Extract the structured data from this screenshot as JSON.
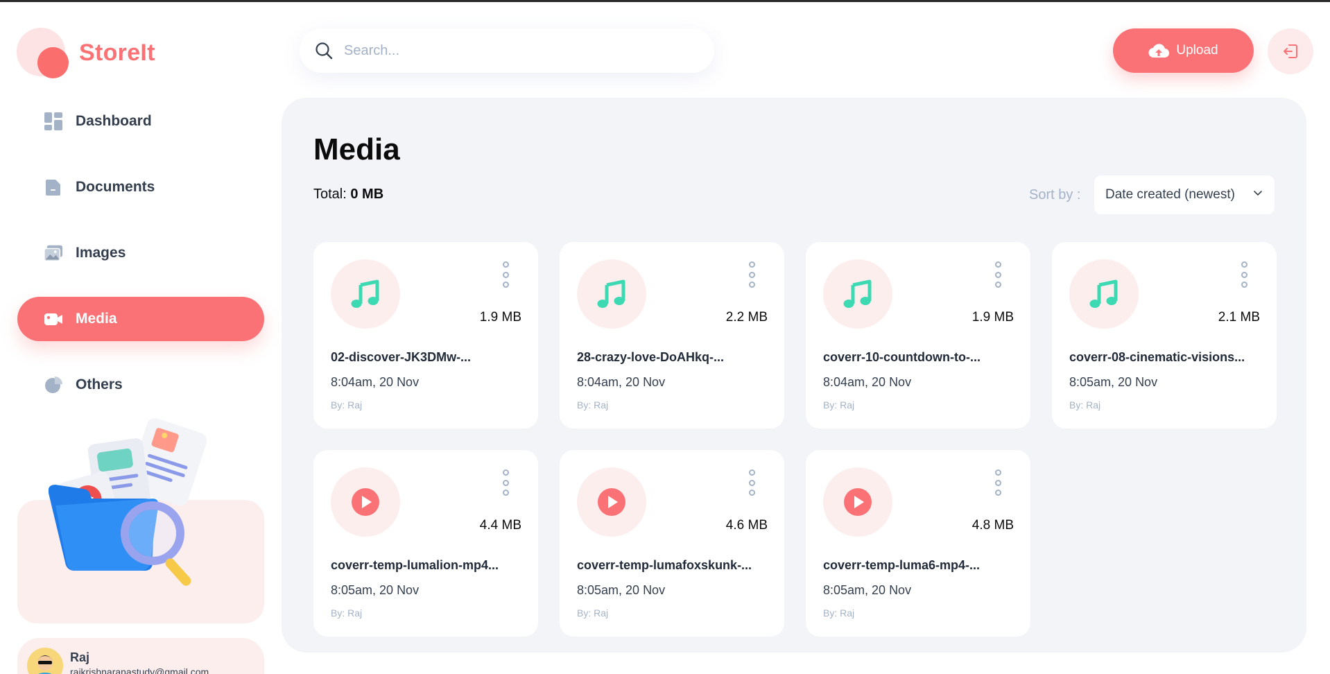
{
  "app": {
    "name": "StoreIt"
  },
  "sidebar": {
    "items": [
      {
        "label": "Dashboard",
        "icon": "dashboard-icon",
        "active": false
      },
      {
        "label": "Documents",
        "icon": "documents-icon",
        "active": false
      },
      {
        "label": "Images",
        "icon": "images-icon",
        "active": false
      },
      {
        "label": "Media",
        "icon": "media-icon",
        "active": true
      },
      {
        "label": "Others",
        "icon": "others-icon",
        "active": false
      }
    ]
  },
  "user": {
    "name": "Raj",
    "email": "rajkrishnaranastudy@gmail.com"
  },
  "search": {
    "placeholder": "Search..."
  },
  "header": {
    "upload_label": "Upload"
  },
  "page": {
    "title": "Media",
    "total_label": "Total:",
    "total_value": "0 MB",
    "sort_label": "Sort by :",
    "sort_value": "Date created (newest)"
  },
  "files": [
    {
      "name": "02-discover-JK3DMw-...",
      "size": "1.9 MB",
      "date": "8:04am, 20 Nov",
      "by": "By: Raj",
      "type": "audio"
    },
    {
      "name": "28-crazy-love-DoAHkq-...",
      "size": "2.2 MB",
      "date": "8:04am, 20 Nov",
      "by": "By: Raj",
      "type": "audio"
    },
    {
      "name": "coverr-10-countdown-to-...",
      "size": "1.9 MB",
      "date": "8:04am, 20 Nov",
      "by": "By: Raj",
      "type": "audio"
    },
    {
      "name": "coverr-08-cinematic-visions...",
      "size": "2.1 MB",
      "date": "8:05am, 20 Nov",
      "by": "By: Raj",
      "type": "audio"
    },
    {
      "name": "coverr-temp-lumalion-mp4...",
      "size": "4.4 MB",
      "date": "8:05am, 20 Nov",
      "by": "By: Raj",
      "type": "video"
    },
    {
      "name": "coverr-temp-lumafoxskunk-...",
      "size": "4.6 MB",
      "date": "8:05am, 20 Nov",
      "by": "By: Raj",
      "type": "video"
    },
    {
      "name": "coverr-temp-luma6-mp4-...",
      "size": "4.8 MB",
      "date": "8:05am, 20 Nov",
      "by": "By: Raj",
      "type": "video"
    }
  ],
  "colors": {
    "brand": "#fa7275",
    "brand_light": "#fdeeee",
    "audio_icon": "#3dd9b3",
    "video_icon": "#fa7275",
    "main_bg": "#f2f4f8",
    "muted_text": "#a3b2c7"
  }
}
